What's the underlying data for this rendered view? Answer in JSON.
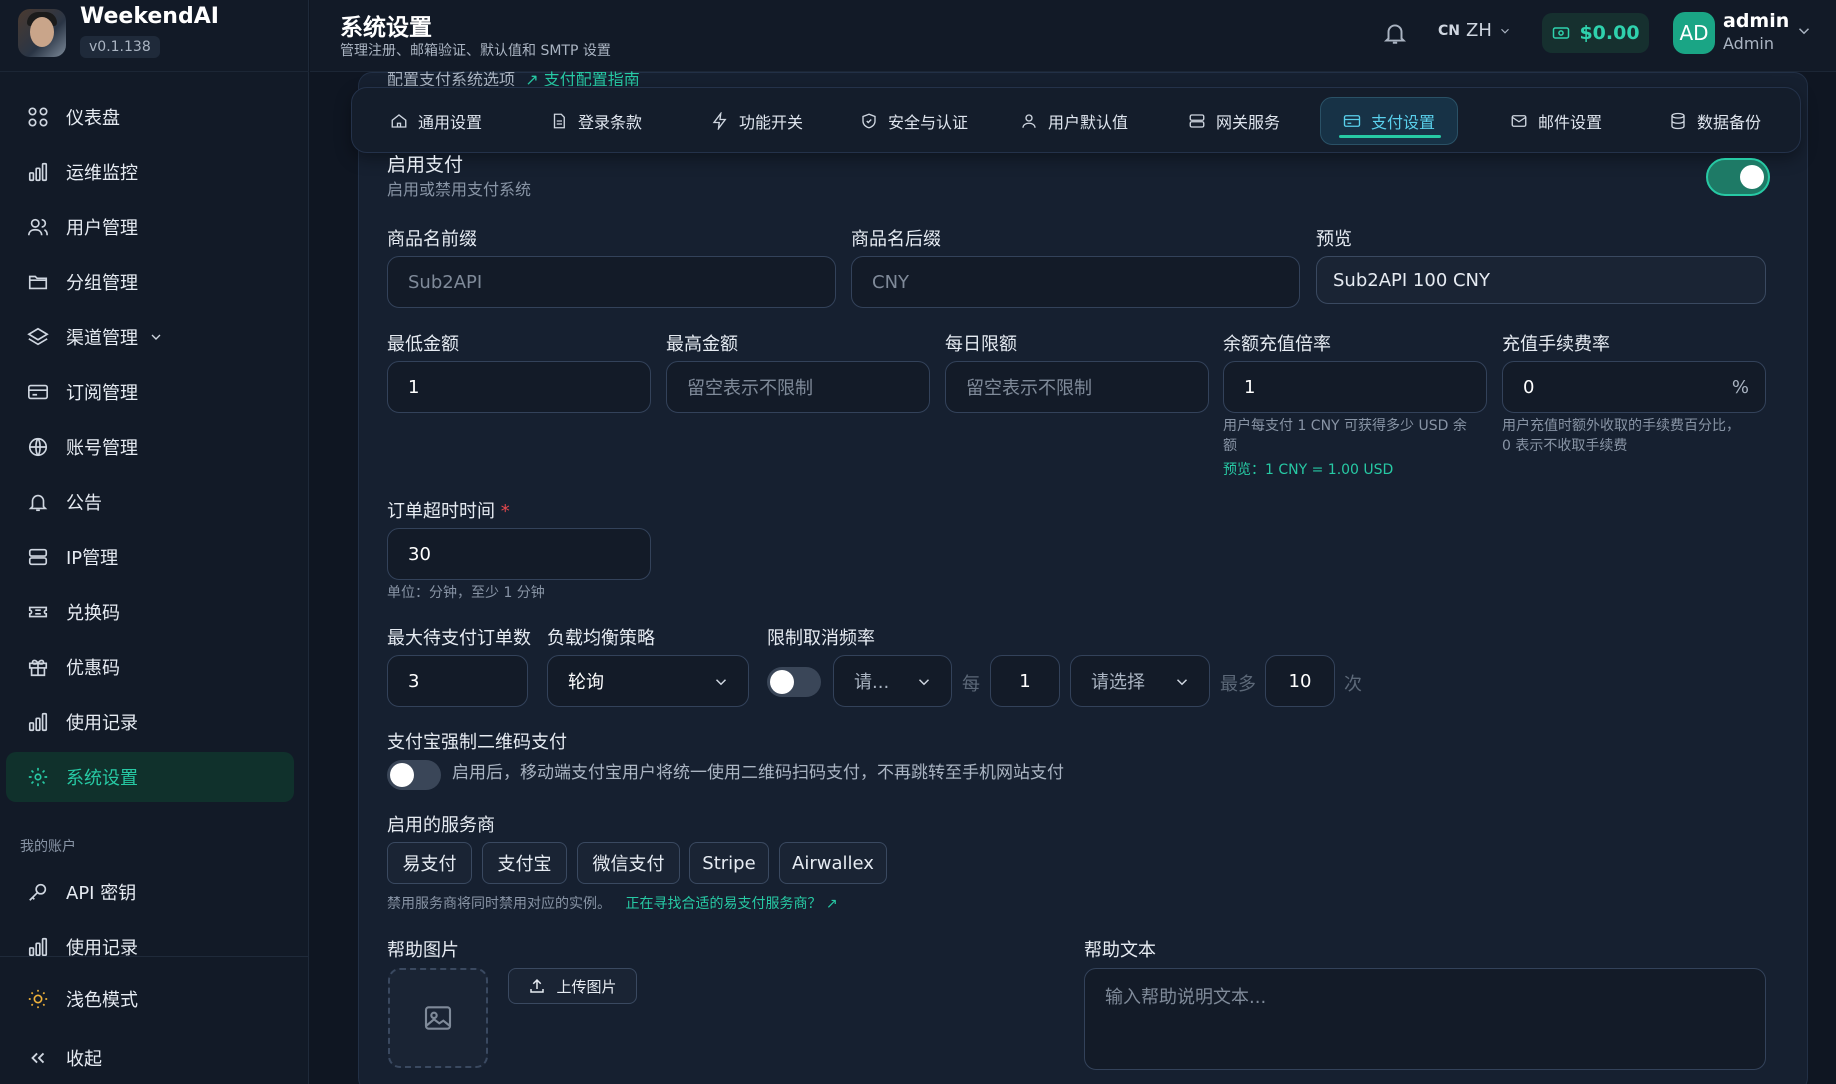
{
  "brand": {
    "name": "WeekendAI",
    "version": "v0.1.138"
  },
  "sidebar": {
    "items": [
      {
        "label": "仪表盘"
      },
      {
        "label": "运维监控"
      },
      {
        "label": "用户管理"
      },
      {
        "label": "分组管理"
      },
      {
        "label": "渠道管理"
      },
      {
        "label": "订阅管理"
      },
      {
        "label": "账号管理"
      },
      {
        "label": "公告"
      },
      {
        "label": "IP管理"
      },
      {
        "label": "兑换码"
      },
      {
        "label": "优惠码"
      },
      {
        "label": "使用记录"
      },
      {
        "label": "系统设置"
      }
    ],
    "section_account": "我的账户",
    "account_items": [
      {
        "label": "API 密钥"
      },
      {
        "label": "使用记录"
      }
    ],
    "theme_toggle": "浅色模式",
    "collapse": "收起"
  },
  "header": {
    "title": "系统设置",
    "subtitle": "管理注册、邮箱验证、默认值和 SMTP 设置",
    "lang_code": "CN",
    "lang": "ZH",
    "balance": "$0.00",
    "user_initials": "AD",
    "user_name": "admin",
    "user_role": "Admin"
  },
  "partial_text": {
    "text": "配置支付系统选项",
    "link": "支付配置指南"
  },
  "tabs": [
    {
      "label": "通用设置"
    },
    {
      "label": "登录条款"
    },
    {
      "label": "功能开关"
    },
    {
      "label": "安全与认证"
    },
    {
      "label": "用户默认值"
    },
    {
      "label": "网关服务"
    },
    {
      "label": "支付设置"
    },
    {
      "label": "邮件设置"
    },
    {
      "label": "数据备份"
    }
  ],
  "payment": {
    "enable_title": "启用支付",
    "enable_desc": "启用或禁用支付系统",
    "enabled": true,
    "prefix_label": "商品名前缀",
    "prefix_value": "Sub2API",
    "suffix_label": "商品名后缀",
    "suffix_value": "CNY",
    "preview_label": "预览",
    "preview_value": "Sub2API 100 CNY",
    "min_label": "最低金额",
    "min_value": "1",
    "max_label": "最高金额",
    "max_placeholder": "留空表示不限制",
    "daily_label": "每日限额",
    "daily_placeholder": "留空表示不限制",
    "ratio_label": "余额充值倍率",
    "ratio_value": "1",
    "ratio_hint_1": "用户每支付 1 CNY 可获得多少 USD 余",
    "ratio_hint_2": "额",
    "ratio_preview": "预览：1 CNY = 1.00 USD",
    "fee_label": "充值手续费率",
    "fee_value": "0",
    "fee_unit": "%",
    "fee_hint_1": "用户充值时额外收取的手续费百分比，",
    "fee_hint_2": "0 表示不收取手续费",
    "timeout_label": "订单超时时间",
    "required_mark": "*",
    "timeout_value": "30",
    "timeout_hint": "单位：分钟，至少 1 分钟",
    "max_pending_label": "最大待支付订单数",
    "max_pending_value": "3",
    "lb_label": "负载均衡策略",
    "lb_value": "轮询",
    "cancel_limit_label": "限制取消频率",
    "cancel_limit_enabled": false,
    "cancel_unit_placeholder": "请...",
    "per": "每",
    "per_value": "1",
    "period_placeholder": "请选择",
    "most": "最多",
    "most_value": "10",
    "times": "次",
    "alipay_qr_label": "支付宝强制二维码支付",
    "alipay_qr_enabled": false,
    "alipay_qr_desc": "启用后，移动端支付宝用户将统一使用二维码扫码支付，不再跳转至手机网站支付",
    "providers_label": "启用的服务商",
    "providers": [
      {
        "label": "易支付"
      },
      {
        "label": "支付宝"
      },
      {
        "label": "微信支付"
      },
      {
        "label": "Stripe"
      },
      {
        "label": "Airwallex"
      }
    ],
    "providers_hint": "禁用服务商将同时禁用对应的实例。",
    "providers_link": "正在寻找合适的易支付服务商？",
    "help_image_label": "帮助图片",
    "upload_label": "上传图片",
    "help_text_label": "帮助文本",
    "help_text_placeholder": "输入帮助说明文本..."
  }
}
